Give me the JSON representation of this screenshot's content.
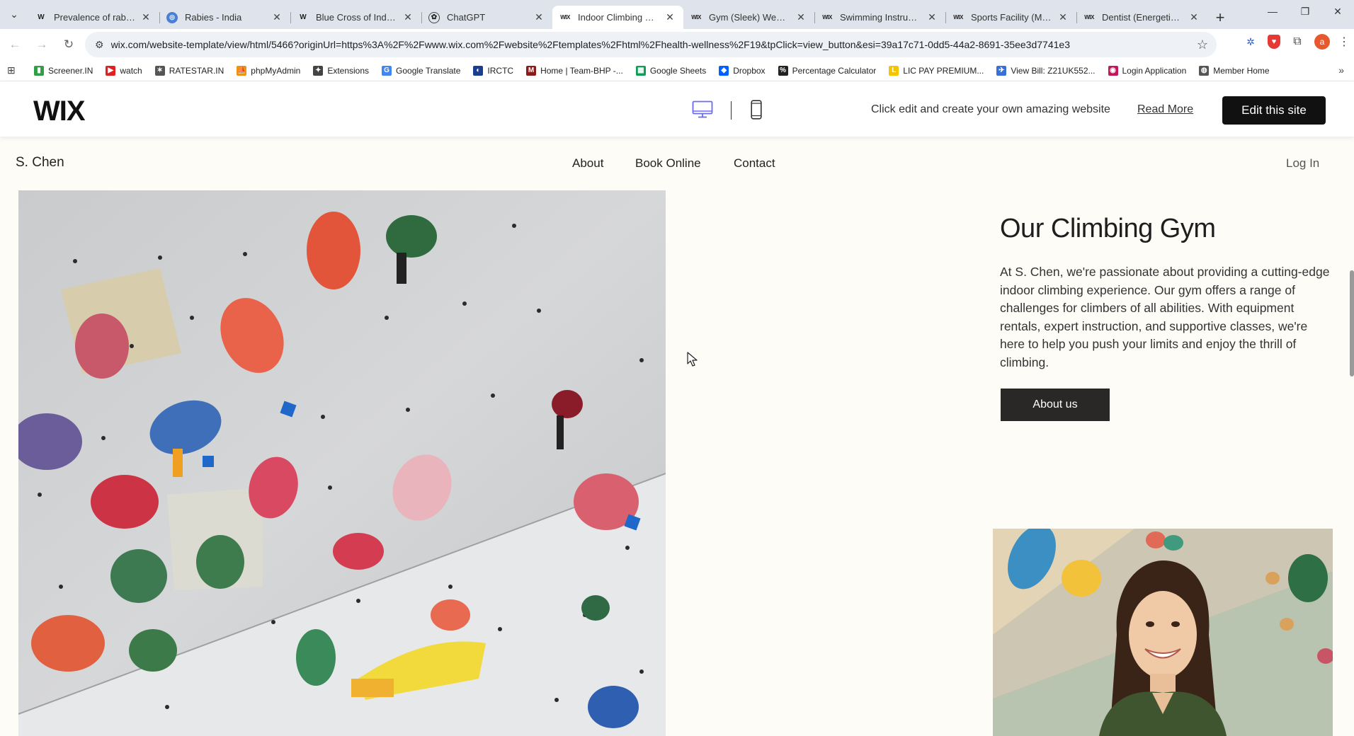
{
  "browser": {
    "tabs": [
      {
        "favicon": "W",
        "title": "Prevalence of rabies",
        "active": false
      },
      {
        "favicon": "globe",
        "title": "Rabies - India",
        "active": false
      },
      {
        "favicon": "W",
        "title": "Blue Cross of India -",
        "active": false
      },
      {
        "favicon": "gpt",
        "title": "ChatGPT",
        "active": false
      },
      {
        "favicon": "wix",
        "title": "Indoor Climbing Gym",
        "active": true
      },
      {
        "favicon": "wix",
        "title": "Gym (Sleek) Website",
        "active": false
      },
      {
        "favicon": "wix",
        "title": "Swimming Instructor",
        "active": false
      },
      {
        "favicon": "wix",
        "title": "Sports Facility (Mode",
        "active": false
      },
      {
        "favicon": "wix",
        "title": "Dentist (Energetic) W",
        "active": false
      }
    ],
    "url": "wix.com/website-template/view/html/5466?originUrl=https%3A%2F%2Fwww.wix.com%2Fwebsite%2Ftemplates%2Fhtml%2Fhealth-wellness%2F19&tpClick=view_button&esi=39a17c71-0dd5-44a2-8691-35ee3d7741e3",
    "profile_initial": "a",
    "bookmarks": [
      {
        "label": "Screener.IN",
        "icon": "chart-icon",
        "color": "#2f9e44"
      },
      {
        "label": "watch",
        "icon": "youtube-icon",
        "color": "#e02020"
      },
      {
        "label": "RATESTAR.IN",
        "icon": "star-icon",
        "color": "#555555"
      },
      {
        "label": "phpMyAdmin",
        "icon": "phpmyadmin-icon",
        "color": "#f29111"
      },
      {
        "label": "Extensions",
        "icon": "puzzle-icon",
        "color": "#444444"
      },
      {
        "label": "Google Translate",
        "icon": "translate-icon",
        "color": "#4285f4"
      },
      {
        "label": "IRCTC",
        "icon": "irctc-icon",
        "color": "#1a3d8f"
      },
      {
        "label": "Home | Team-BHP -...",
        "icon": "teambhp-icon",
        "color": "#8b1a1a"
      },
      {
        "label": "Google Sheets",
        "icon": "sheets-icon",
        "color": "#0f9d58"
      },
      {
        "label": "Dropbox",
        "icon": "dropbox-icon",
        "color": "#0061fe"
      },
      {
        "label": "Percentage Calculator",
        "icon": "percent-icon",
        "color": "#222222"
      },
      {
        "label": "LIC PAY PREMIUM...",
        "icon": "lic-icon",
        "color": "#f5c400"
      },
      {
        "label": "View Bill: Z21UK552...",
        "icon": "bill-icon",
        "color": "#3a6fd8"
      },
      {
        "label": "Login Application",
        "icon": "login-icon",
        "color": "#c2185b"
      },
      {
        "label": "Member Home",
        "icon": "globe-icon",
        "color": "#555555"
      }
    ]
  },
  "wix_bar": {
    "logo": "WIX",
    "promo_text": "Click edit and create your own amazing website",
    "read_more": "Read More",
    "edit_button": "Edit this site"
  },
  "site": {
    "brand": "S. Chen",
    "nav": [
      "About",
      "Book Online",
      "Contact"
    ],
    "login": "Log In",
    "title": "Our Climbing Gym",
    "description": "At S. Chen, we're passionate about providing a cutting-edge indoor climbing experience. Our gym offers a range of challenges for climbers of all abilities. With equipment rentals, expert instruction, and supportive classes, we're here to help you push your limits and enjoy the thrill of climbing.",
    "about_button": "About us"
  },
  "colors": {
    "page_bg": "#fdfcf7",
    "button_dark": "#2a2826",
    "edit_button": "#111111",
    "device_icon_active": "#6b6bf5"
  }
}
